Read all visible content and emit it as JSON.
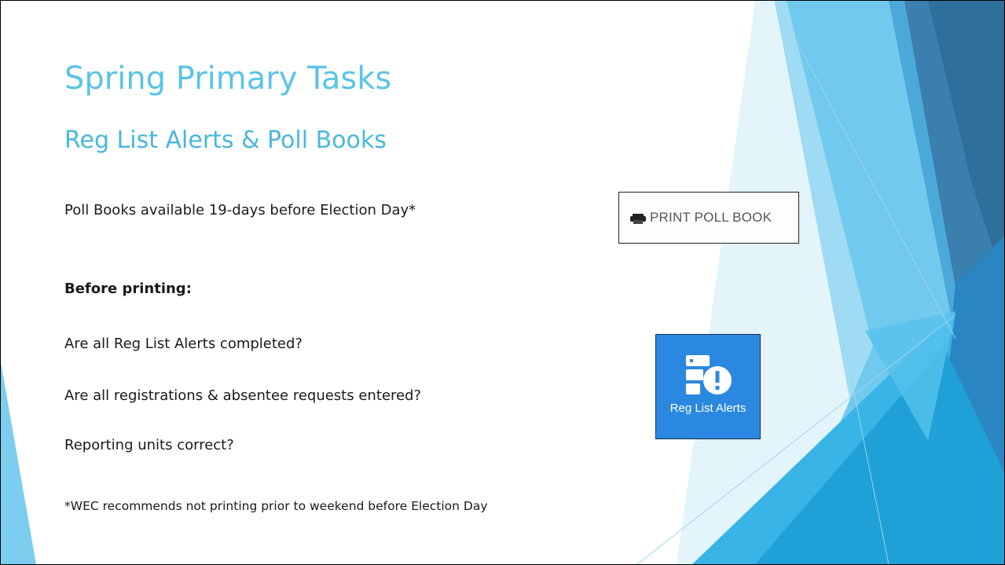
{
  "slide": {
    "title": "Spring Primary Tasks",
    "subtitle": "Reg List Alerts & Poll Books",
    "lines": [
      "Poll Books available 19-days before Election Day*",
      "Before printing:",
      "Are all Reg List Alerts completed?",
      "Are all registrations & absentee requests entered?",
      "Reporting units correct?"
    ],
    "footnote": "*WEC recommends not printing prior to weekend before Election Day"
  },
  "poll_book_button": {
    "label": "PRINT POLL BOOK",
    "icon": "printer-icon"
  },
  "reg_list_alerts_tile": {
    "label": "Reg List Alerts",
    "icon": "list-alert-icon"
  },
  "colors": {
    "title": "#5bc4e6",
    "tile": "#2b88e0",
    "accent_dark": "#2a6f9e",
    "accent_light": "#8fd3f0"
  }
}
